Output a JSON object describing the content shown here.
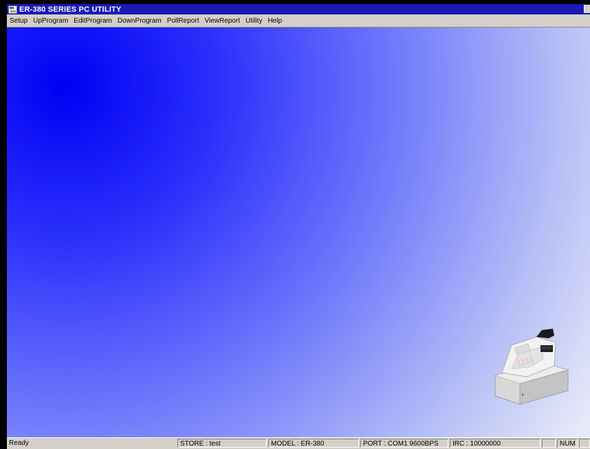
{
  "window": {
    "title": "ER-380 SERIES PC UTILITY"
  },
  "menu": {
    "items": [
      {
        "label": "Setup"
      },
      {
        "label": "UpProgram"
      },
      {
        "label": "EditProgram"
      },
      {
        "label": "DownProgram"
      },
      {
        "label": "PollReport"
      },
      {
        "label": "ViewReport"
      },
      {
        "label": "Utility"
      },
      {
        "label": "Help"
      }
    ]
  },
  "status": {
    "ready": "Ready",
    "store": "STORE : test",
    "model": "MODEL : ER-380",
    "port": "PORT : COM1  9600BPS",
    "irc": "IRC : 10000000",
    "num": "NUM"
  },
  "icons": {
    "app": "app-icon",
    "register_image": "cash-register-image"
  }
}
